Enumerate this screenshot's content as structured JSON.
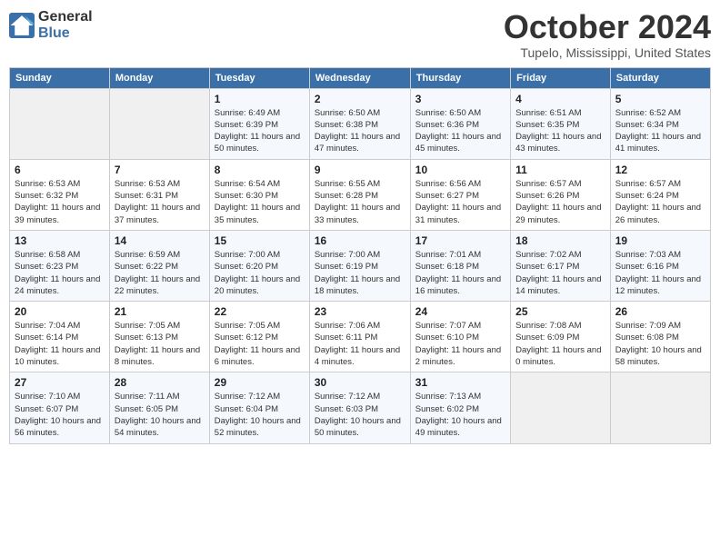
{
  "logo": {
    "line1": "General",
    "line2": "Blue"
  },
  "title": "October 2024",
  "location": "Tupelo, Mississippi, United States",
  "days_of_week": [
    "Sunday",
    "Monday",
    "Tuesday",
    "Wednesday",
    "Thursday",
    "Friday",
    "Saturday"
  ],
  "weeks": [
    [
      {
        "day": "",
        "empty": true
      },
      {
        "day": "",
        "empty": true
      },
      {
        "day": "1",
        "sunrise": "6:49 AM",
        "sunset": "6:39 PM",
        "daylight": "11 hours and 50 minutes."
      },
      {
        "day": "2",
        "sunrise": "6:50 AM",
        "sunset": "6:38 PM",
        "daylight": "11 hours and 47 minutes."
      },
      {
        "day": "3",
        "sunrise": "6:50 AM",
        "sunset": "6:36 PM",
        "daylight": "11 hours and 45 minutes."
      },
      {
        "day": "4",
        "sunrise": "6:51 AM",
        "sunset": "6:35 PM",
        "daylight": "11 hours and 43 minutes."
      },
      {
        "day": "5",
        "sunrise": "6:52 AM",
        "sunset": "6:34 PM",
        "daylight": "11 hours and 41 minutes."
      }
    ],
    [
      {
        "day": "6",
        "sunrise": "6:53 AM",
        "sunset": "6:32 PM",
        "daylight": "11 hours and 39 minutes."
      },
      {
        "day": "7",
        "sunrise": "6:53 AM",
        "sunset": "6:31 PM",
        "daylight": "11 hours and 37 minutes."
      },
      {
        "day": "8",
        "sunrise": "6:54 AM",
        "sunset": "6:30 PM",
        "daylight": "11 hours and 35 minutes."
      },
      {
        "day": "9",
        "sunrise": "6:55 AM",
        "sunset": "6:28 PM",
        "daylight": "11 hours and 33 minutes."
      },
      {
        "day": "10",
        "sunrise": "6:56 AM",
        "sunset": "6:27 PM",
        "daylight": "11 hours and 31 minutes."
      },
      {
        "day": "11",
        "sunrise": "6:57 AM",
        "sunset": "6:26 PM",
        "daylight": "11 hours and 29 minutes."
      },
      {
        "day": "12",
        "sunrise": "6:57 AM",
        "sunset": "6:24 PM",
        "daylight": "11 hours and 26 minutes."
      }
    ],
    [
      {
        "day": "13",
        "sunrise": "6:58 AM",
        "sunset": "6:23 PM",
        "daylight": "11 hours and 24 minutes."
      },
      {
        "day": "14",
        "sunrise": "6:59 AM",
        "sunset": "6:22 PM",
        "daylight": "11 hours and 22 minutes."
      },
      {
        "day": "15",
        "sunrise": "7:00 AM",
        "sunset": "6:20 PM",
        "daylight": "11 hours and 20 minutes."
      },
      {
        "day": "16",
        "sunrise": "7:00 AM",
        "sunset": "6:19 PM",
        "daylight": "11 hours and 18 minutes."
      },
      {
        "day": "17",
        "sunrise": "7:01 AM",
        "sunset": "6:18 PM",
        "daylight": "11 hours and 16 minutes."
      },
      {
        "day": "18",
        "sunrise": "7:02 AM",
        "sunset": "6:17 PM",
        "daylight": "11 hours and 14 minutes."
      },
      {
        "day": "19",
        "sunrise": "7:03 AM",
        "sunset": "6:16 PM",
        "daylight": "11 hours and 12 minutes."
      }
    ],
    [
      {
        "day": "20",
        "sunrise": "7:04 AM",
        "sunset": "6:14 PM",
        "daylight": "11 hours and 10 minutes."
      },
      {
        "day": "21",
        "sunrise": "7:05 AM",
        "sunset": "6:13 PM",
        "daylight": "11 hours and 8 minutes."
      },
      {
        "day": "22",
        "sunrise": "7:05 AM",
        "sunset": "6:12 PM",
        "daylight": "11 hours and 6 minutes."
      },
      {
        "day": "23",
        "sunrise": "7:06 AM",
        "sunset": "6:11 PM",
        "daylight": "11 hours and 4 minutes."
      },
      {
        "day": "24",
        "sunrise": "7:07 AM",
        "sunset": "6:10 PM",
        "daylight": "11 hours and 2 minutes."
      },
      {
        "day": "25",
        "sunrise": "7:08 AM",
        "sunset": "6:09 PM",
        "daylight": "11 hours and 0 minutes."
      },
      {
        "day": "26",
        "sunrise": "7:09 AM",
        "sunset": "6:08 PM",
        "daylight": "10 hours and 58 minutes."
      }
    ],
    [
      {
        "day": "27",
        "sunrise": "7:10 AM",
        "sunset": "6:07 PM",
        "daylight": "10 hours and 56 minutes."
      },
      {
        "day": "28",
        "sunrise": "7:11 AM",
        "sunset": "6:05 PM",
        "daylight": "10 hours and 54 minutes."
      },
      {
        "day": "29",
        "sunrise": "7:12 AM",
        "sunset": "6:04 PM",
        "daylight": "10 hours and 52 minutes."
      },
      {
        "day": "30",
        "sunrise": "7:12 AM",
        "sunset": "6:03 PM",
        "daylight": "10 hours and 50 minutes."
      },
      {
        "day": "31",
        "sunrise": "7:13 AM",
        "sunset": "6:02 PM",
        "daylight": "10 hours and 49 minutes."
      },
      {
        "day": "",
        "empty": true
      },
      {
        "day": "",
        "empty": true
      }
    ]
  ]
}
